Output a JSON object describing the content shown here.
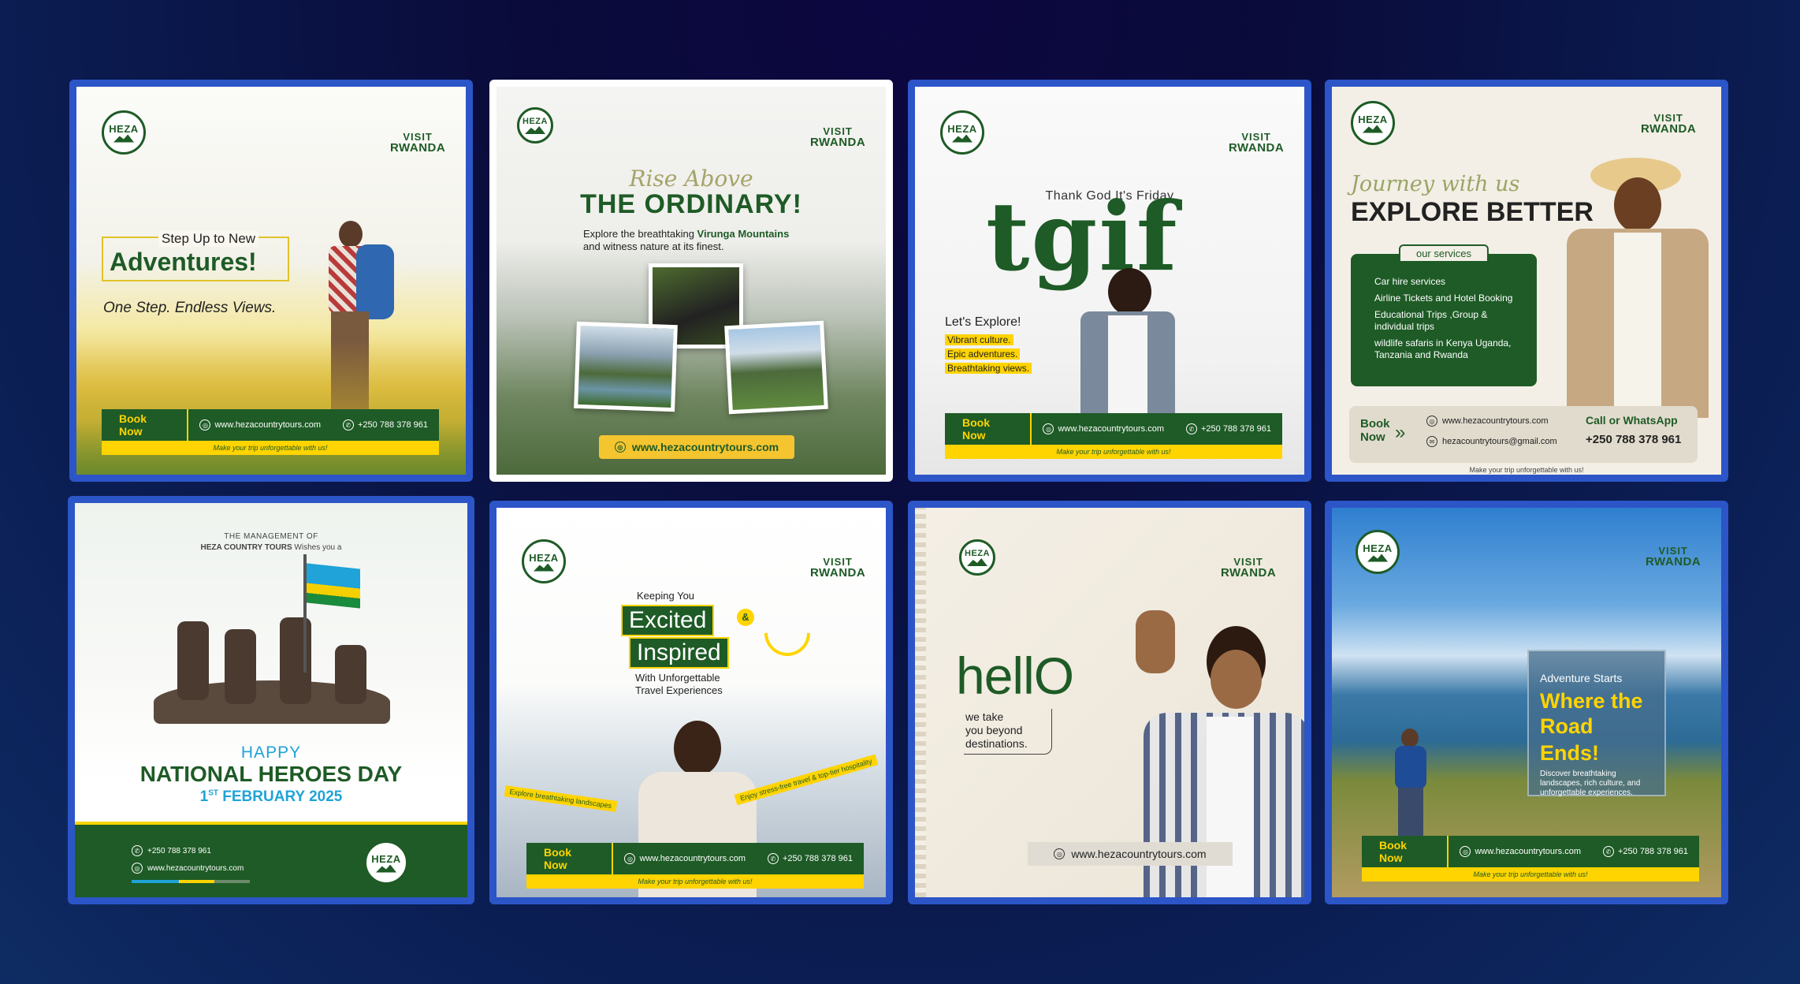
{
  "brand": {
    "logo": "HEZA",
    "visit_line1": "VISIT",
    "visit_line2": "RWANDA",
    "book_now": "Book Now",
    "website": "www.hezacountrytours.com",
    "phone": "+250 788 378 961",
    "tagline": "Make your trip unforgettable with us!",
    "email": "hezacountrytours@gmail.com"
  },
  "colors": {
    "background": "#0b1a50",
    "card_border": "#2c55c8",
    "brand_green": "#1e5b26",
    "brand_yellow": "#ffd400",
    "rwanda_blue": "#1fa3d8"
  },
  "cards": [
    {
      "title_small": "Step Up to New",
      "title": "Adventures!",
      "subtitle": "One Step. Endless Views."
    },
    {
      "script": "Rise Above",
      "title": "THE ORDINARY!",
      "body_prefix": "Explore the breathtaking ",
      "body_highlight": "Virunga Mountains",
      "body_suffix": "and witness nature at its finest."
    },
    {
      "top": "Thank God It's Friday",
      "big": "tgif",
      "explore": "Let's Explore!",
      "bullets": [
        "Vibrant culture.",
        "Epic adventures.",
        "Breathtaking views."
      ]
    },
    {
      "script": "Journey with us",
      "title": "EXPLORE BETTER",
      "services_heading": "our services",
      "services": [
        "Car hire services",
        "Airline Tickets and Hotel Booking",
        "Educational Trips ,Group & individual trips",
        "wildlife safaris in Kenya Uganda, Tanzania and Rwanda"
      ],
      "book_line1": "Book",
      "book_line2": "Now",
      "call": "Call or WhatsApp"
    },
    {
      "mgmt_line1": "THE MANAGEMENT OF",
      "mgmt_line2_bold": "HEZA COUNTRY TOURS",
      "mgmt_line2_rest": " Wishes you a",
      "happy": "HAPPY",
      "title": "NATIONAL HEROES DAY",
      "date_day": "1",
      "date_sup": "ST",
      "date_rest": " FEBRUARY 2025"
    },
    {
      "keeping": "Keeping You",
      "excited": "Excited",
      "amp": "&",
      "inspired": "Inspired",
      "with": "With Unforgettable",
      "travel": "Travel Experiences",
      "ribbon_left": "Explore breathtaking landscapes",
      "ribbon_right": "Enjoy stress-free travel & top-tier hospitality"
    },
    {
      "big": "hellO",
      "sub_line1": "we take",
      "sub_line2": "you beyond",
      "sub_line3": "destinations."
    },
    {
      "kicker": "Adventure Starts",
      "title_line1": "Where the",
      "title_line2": "Road Ends!",
      "body": "Discover breathtaking landscapes, rich culture, and unforgettable experiences."
    }
  ]
}
